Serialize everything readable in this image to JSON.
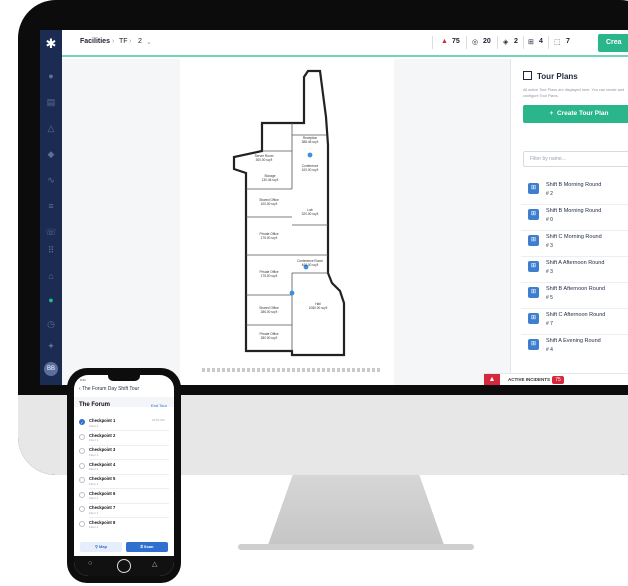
{
  "app": {
    "breadcrumb": [
      "Facilities",
      "TF",
      "2"
    ],
    "stats": [
      {
        "icon": "warning-icon",
        "value": "75",
        "color": "#d6283d"
      },
      {
        "icon": "camera-icon",
        "value": "20"
      },
      {
        "icon": "layers-icon",
        "value": "2"
      },
      {
        "icon": "grid-icon",
        "value": "4"
      },
      {
        "icon": "dashed-square-icon",
        "value": "7"
      }
    ],
    "create_label": "Crea",
    "accent": "#2bb58a",
    "sidebar_bg": "#1b2b52"
  },
  "floor_plan": {
    "rooms": [
      {
        "name": "Reception",
        "area": "388.46 sq ft"
      },
      {
        "name": "Conference",
        "area": "100.00 sq ft"
      },
      {
        "name": "Server Room",
        "area": "300.00 sq ft"
      },
      {
        "name": "Storage",
        "area": "130.46 sq ft"
      },
      {
        "name": "Shared Office",
        "area": "100.00 sq ft"
      },
      {
        "name": "Lab",
        "area": "320.00 sq ft"
      },
      {
        "name": "Private Office",
        "area": "175.00 sq ft"
      },
      {
        "name": "Private Office",
        "area": "175.00 sq ft"
      },
      {
        "name": "Conference Room",
        "area": "400.00 sq ft"
      },
      {
        "name": "Shared Office",
        "area": "286.00 sq ft"
      },
      {
        "name": "Hall",
        "area": "1080.00 sq ft"
      },
      {
        "name": "Private Office",
        "area": "280.00 sq ft"
      }
    ]
  },
  "panel": {
    "title": "Tour Plans",
    "description": "All active Tour Plans are displayed here. You can create and configure Tour Plans.",
    "create_button": "Create Tour Plan",
    "filter_placeholder": "Filter by name...",
    "tours": [
      {
        "name": "Shift B Morning Round",
        "number": "2"
      },
      {
        "name": "Shift B Morning Round",
        "number": "0"
      },
      {
        "name": "Shift C Morning Round",
        "number": "3"
      },
      {
        "name": "Shift A Afternoon Round",
        "number": "3"
      },
      {
        "name": "Shift B Afternoon Round",
        "number": "5"
      },
      {
        "name": "Shift C Afternoon Round",
        "number": "7"
      },
      {
        "name": "Shift A Evening Round",
        "number": "4"
      }
    ],
    "incidents_label": "ACTIVE INCIDENTS",
    "incidents_count": "75"
  },
  "phone": {
    "status_time": "9:41",
    "back_label": "The Forum Day Shift Tour",
    "venue": "The Forum",
    "end_label": "End Tour",
    "checkpoints": [
      {
        "name": "Checkpoint 1",
        "floor": "Floor 1",
        "time": "10:51 AM",
        "done": true
      },
      {
        "name": "Checkpoint 2",
        "floor": "Floor 1",
        "time": "",
        "done": false
      },
      {
        "name": "Checkpoint 3",
        "floor": "Floor 1",
        "time": "",
        "done": false
      },
      {
        "name": "Checkpoint 4",
        "floor": "Floor 1",
        "time": "",
        "done": false
      },
      {
        "name": "Checkpoint 5",
        "floor": "Floor 1",
        "time": "",
        "done": false
      },
      {
        "name": "Checkpoint 6",
        "floor": "Floor 1",
        "time": "",
        "done": false
      },
      {
        "name": "Checkpoint 7",
        "floor": "Floor 1",
        "time": "",
        "done": false
      },
      {
        "name": "Checkpoint 8",
        "floor": "Floor 1",
        "time": "",
        "done": false
      }
    ],
    "map_button": "Map",
    "scan_button": "Scan"
  }
}
